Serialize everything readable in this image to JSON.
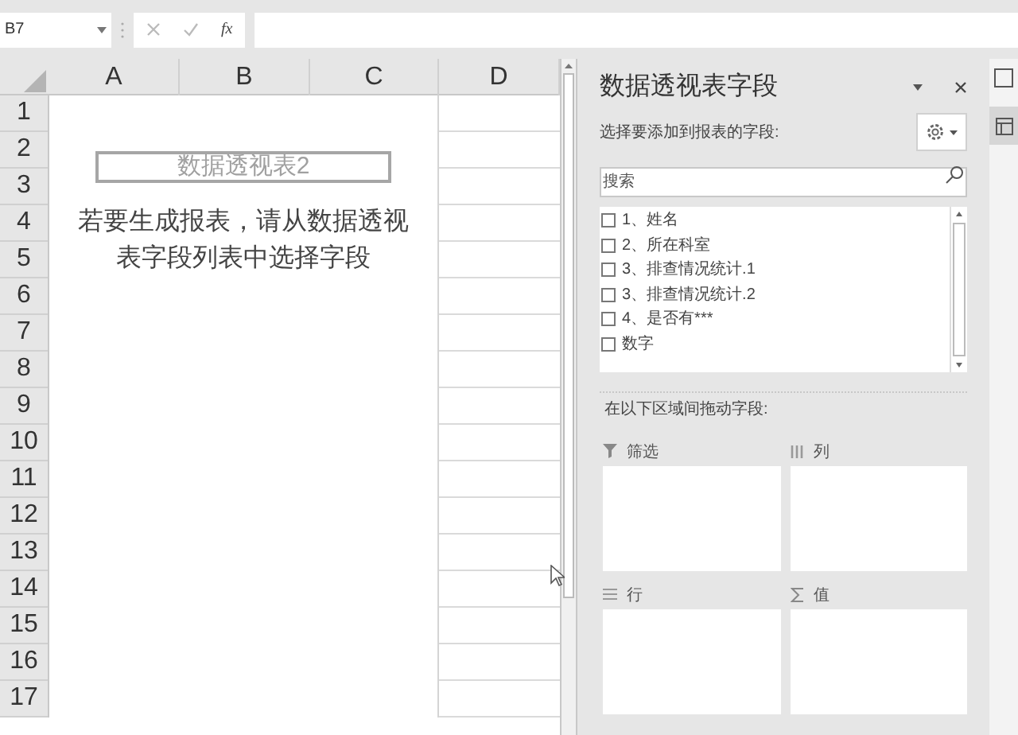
{
  "formula_bar": {
    "name_box": "B7",
    "function_label": "fx"
  },
  "sheet": {
    "columns": [
      "A",
      "B",
      "C",
      "D"
    ],
    "rows": [
      "1",
      "2",
      "3",
      "4",
      "5",
      "6",
      "7",
      "8",
      "9",
      "10",
      "11",
      "12",
      "13",
      "14",
      "15",
      "16",
      "17"
    ],
    "pivot_placeholder": {
      "title": "数据透视表2",
      "message": "若要生成报表，请从数据透视表字段列表中选择字段"
    }
  },
  "pivot_panel": {
    "title": "数据透视表字段",
    "subtitle": "选择要添加到报表的字段:",
    "search": {
      "placeholder": "搜索"
    },
    "fields": [
      {
        "label": "1、姓名",
        "checked": false
      },
      {
        "label": "2、所在科室",
        "checked": false
      },
      {
        "label": "3、排查情况统计.1",
        "checked": false
      },
      {
        "label": "3、排查情况统计.2",
        "checked": false
      },
      {
        "label": "4、是否有***",
        "checked": false
      },
      {
        "label": "数字",
        "checked": false
      }
    ],
    "drag_label": "在以下区域间拖动字段:",
    "areas": [
      {
        "kind": "filter",
        "label": "筛选"
      },
      {
        "kind": "columns",
        "label": "列"
      },
      {
        "kind": "rows",
        "label": "行"
      },
      {
        "kind": "values",
        "label": "值"
      }
    ]
  }
}
